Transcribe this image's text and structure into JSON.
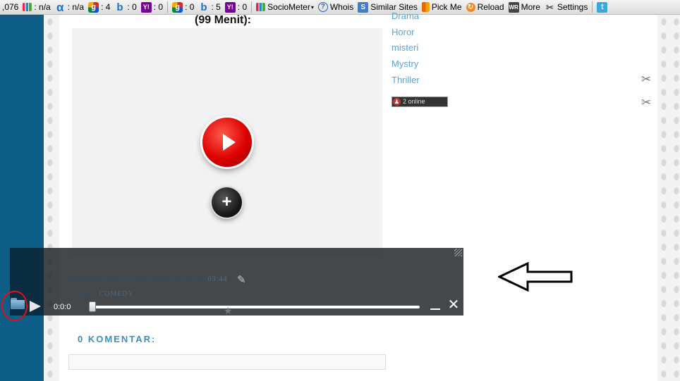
{
  "toolbar": {
    "items": [
      {
        "icon": "none",
        "text": ",076"
      },
      {
        "icon": "bars",
        "text": ": n/a"
      },
      {
        "icon": "alpha",
        "text": ": n/a"
      },
      {
        "icon": "google",
        "text": ": 4"
      },
      {
        "icon": "bing",
        "text": ": 0"
      },
      {
        "icon": "yahoo",
        "text": ": 0"
      },
      {
        "icon": "google",
        "text": ": 0"
      },
      {
        "icon": "bing",
        "text": ": 5"
      },
      {
        "icon": "yahoo",
        "text": ": 0"
      }
    ],
    "sociometer": "SocioMeter",
    "whois": "Whois",
    "similar_sites": "Similar Sites",
    "pick_me": "Pick Me",
    "reload": "Reload",
    "more": "More",
    "settings": "Settings"
  },
  "post": {
    "heading": "(99 Menit):",
    "meta_prefix": "DIPOSKAN OLEH SHIDDIQ BLOG DI",
    "meta_time": "03:44",
    "label_prefix": "LABEL:",
    "label_category": "COMEDY"
  },
  "sidebar": {
    "labels": [
      "Drama",
      "Horor",
      "misteri",
      "Mystry",
      "Thriller"
    ],
    "online_count": "2",
    "online_text": "online"
  },
  "comments": {
    "title": "0 KOMENTAR:"
  },
  "player": {
    "time": "0:0:0",
    "progress": 0
  },
  "colors": {
    "background": "#0e5d86",
    "link": "#57a6d6",
    "annotation": "#e0101a"
  }
}
